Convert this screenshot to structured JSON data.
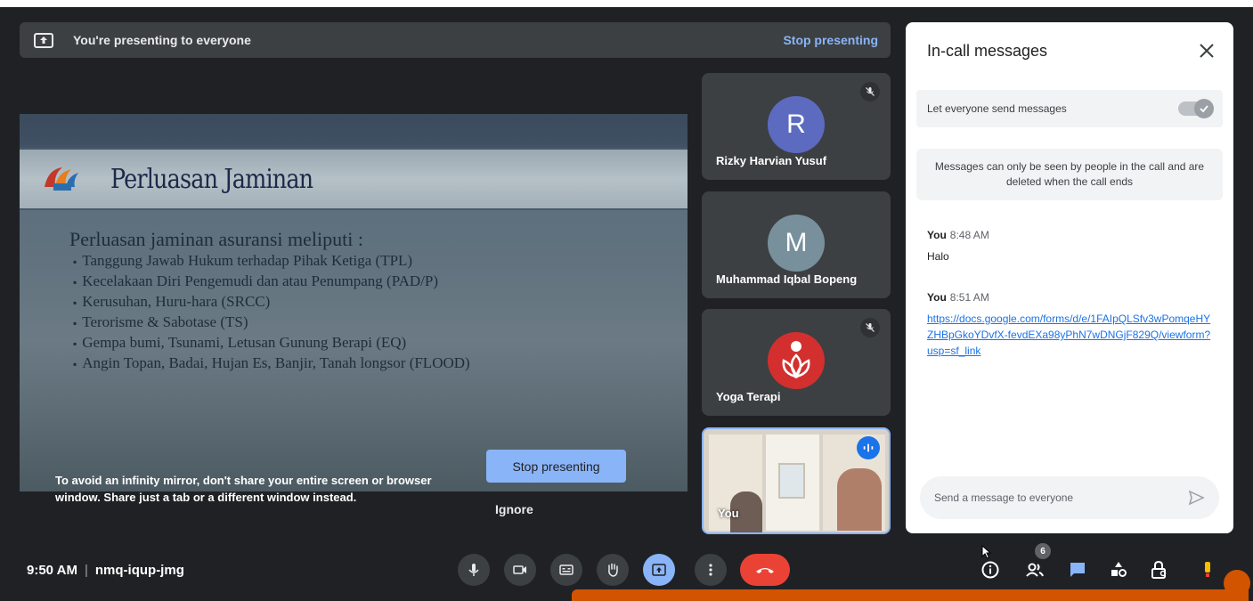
{
  "banner": {
    "text": "You're presenting to everyone",
    "stop_label": "Stop presenting"
  },
  "slide": {
    "title": "Perluasan Jaminan",
    "lead": "Perluasan jaminan asuransi meliputi :",
    "items": [
      "Tanggung Jawab Hukum terhadap Pihak Ketiga (TPL)",
      "Kecelakaan Diri Pengemudi dan atau Penumpang (PAD/P)",
      "Kerusuhan, Huru-hara (SRCC)",
      "Terorisme & Sabotase (TS)",
      "Gempa bumi, Tsunami, Letusan Gunung Berapi (EQ)",
      "Angin Topan, Badai, Hujan Es, Banjir, Tanah longsor (FLOOD)"
    ]
  },
  "warning": {
    "text": "To avoid an infinity mirror, don't share your entire screen or browser window. Share just a tab or a different window instead.",
    "stop_label": "Stop presenting",
    "ignore_label": "Ignore"
  },
  "participants": [
    {
      "name": "Rizky Harvian Yusuf",
      "initial": "R",
      "color": "#5c6bc0",
      "muted": true
    },
    {
      "name": "Muhammad Iqbal Bopeng",
      "initial": "M",
      "color": "#78909c",
      "muted": false
    },
    {
      "name": "Yoga Terapi",
      "initial": "",
      "color": "#d32f2f",
      "muted": true
    },
    {
      "name": "You",
      "speaking": true
    }
  ],
  "chat": {
    "title": "In-call messages",
    "toggle_label": "Let everyone send messages",
    "notice": "Messages can only be seen by people in the call and are deleted when the call ends",
    "messages": [
      {
        "sender": "You",
        "time": "8:48 AM",
        "text": "Halo"
      },
      {
        "sender": "You",
        "time": "8:51 AM",
        "link": "https://docs.google.com/forms/d/e/1FAIpQLSfv3wPomqeHYZHBpGkoYDvfX-fevdEXa98yPhN7wDNGjF829Q/viewform?usp=sf_link"
      }
    ],
    "input_placeholder": "Send a message to everyone"
  },
  "footer": {
    "time": "9:50 AM",
    "meeting_code": "nmq-iqup-jmg",
    "people_count": "6"
  },
  "colors": {
    "background": "#202124",
    "accent": "#8ab4f8",
    "end_call": "#ea4335"
  }
}
